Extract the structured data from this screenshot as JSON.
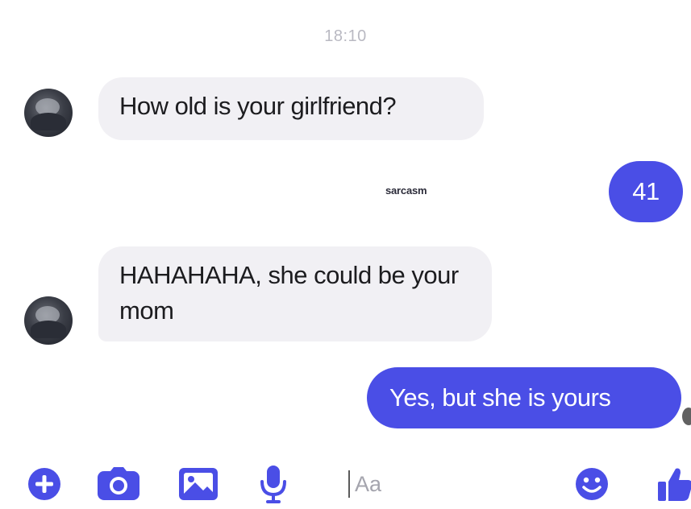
{
  "conversation": {
    "timestamp": "18:10",
    "messages": [
      {
        "sender": "contact",
        "text": "How old is your girlfriend?"
      },
      {
        "sender": "me",
        "text": "41"
      },
      {
        "sender": "contact",
        "text": "HAHAHAHA, she could be your mom"
      },
      {
        "sender": "me",
        "text": "Yes, but she is yours"
      }
    ],
    "caption": "sarcasm"
  },
  "composer": {
    "placeholder": "Aa"
  },
  "icons": {
    "plus": "plus-circle-icon",
    "camera": "camera-icon",
    "image": "image-icon",
    "mic": "microphone-icon",
    "emoji": "emoji-icon",
    "like": "thumbs-up-icon"
  },
  "colors": {
    "accent": "#4a4ee6",
    "incoming_bubble": "#f1f0f4",
    "timestamp": "#b9b9c2"
  }
}
